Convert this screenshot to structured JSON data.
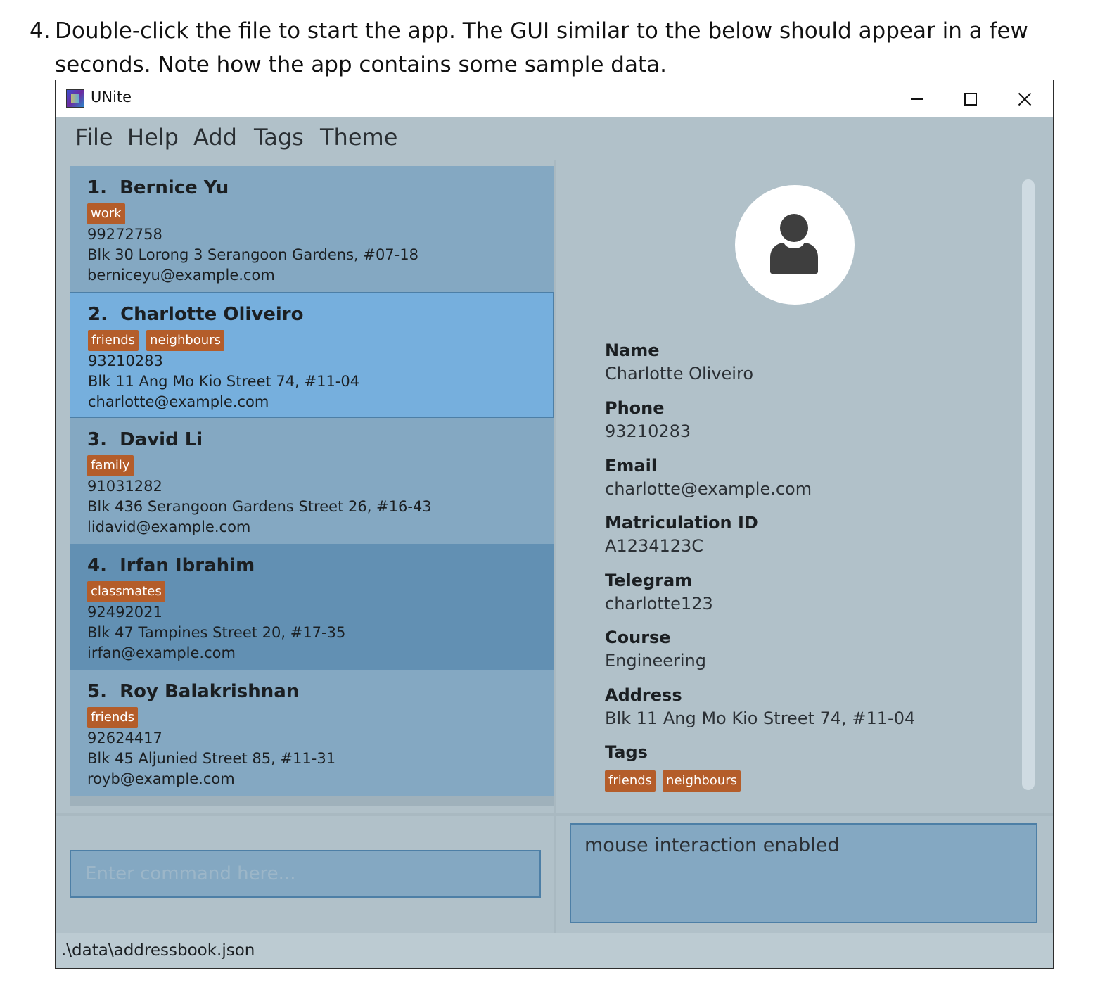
{
  "instruction": {
    "number": "4.",
    "text": "Double-click the file to start the app. The GUI similar to the below should appear in a few seconds. Note how the app contains some sample data."
  },
  "window": {
    "title": "UNite",
    "icon": "app-icon"
  },
  "menu": [
    "File",
    "Help",
    "Add",
    "Tags",
    "Theme"
  ],
  "persons": [
    {
      "index": "1.",
      "name": "Bernice Yu",
      "tags": [
        "work"
      ],
      "phone": "99272758",
      "address": "Blk 30 Lorong 3 Serangoon Gardens, #07-18",
      "email": "berniceyu@example.com"
    },
    {
      "index": "2.",
      "name": "Charlotte Oliveiro",
      "tags": [
        "friends",
        "neighbours"
      ],
      "phone": "93210283",
      "address": "Blk 11 Ang Mo Kio Street 74, #11-04",
      "email": "charlotte@example.com"
    },
    {
      "index": "3.",
      "name": "David Li",
      "tags": [
        "family"
      ],
      "phone": "91031282",
      "address": "Blk 436 Serangoon Gardens Street 26, #16-43",
      "email": "lidavid@example.com"
    },
    {
      "index": "4.",
      "name": "Irfan Ibrahim",
      "tags": [
        "classmates"
      ],
      "phone": "92492021",
      "address": "Blk 47 Tampines Street 20, #17-35",
      "email": "irfan@example.com"
    },
    {
      "index": "5.",
      "name": "Roy Balakrishnan",
      "tags": [
        "friends"
      ],
      "phone": "92624417",
      "address": "Blk 45 Aljunied Street 85, #11-31",
      "email": "royb@example.com"
    }
  ],
  "detail": {
    "name_label": "Name",
    "name": "Charlotte Oliveiro",
    "phone_label": "Phone",
    "phone": "93210283",
    "email_label": "Email",
    "email": "charlotte@example.com",
    "matric_label": "Matriculation ID",
    "matric": "A1234123C",
    "telegram_label": "Telegram",
    "telegram": "charlotte123",
    "course_label": "Course",
    "course": "Engineering",
    "address_label": "Address",
    "address": "Blk 11 Ang Mo Kio Street 74, #11-04",
    "tags_label": "Tags",
    "tags": [
      "friends",
      "neighbours"
    ]
  },
  "command": {
    "placeholder": "Enter command here...",
    "value": ""
  },
  "result": "mouse interaction enabled",
  "status": ".\\data\\addressbook.json",
  "colors": {
    "tag": "#b45d2a",
    "card": "#84a8c2",
    "card_selected": "#76afdd",
    "card_hover": "#6290b3",
    "background": "#b1c1c9"
  }
}
